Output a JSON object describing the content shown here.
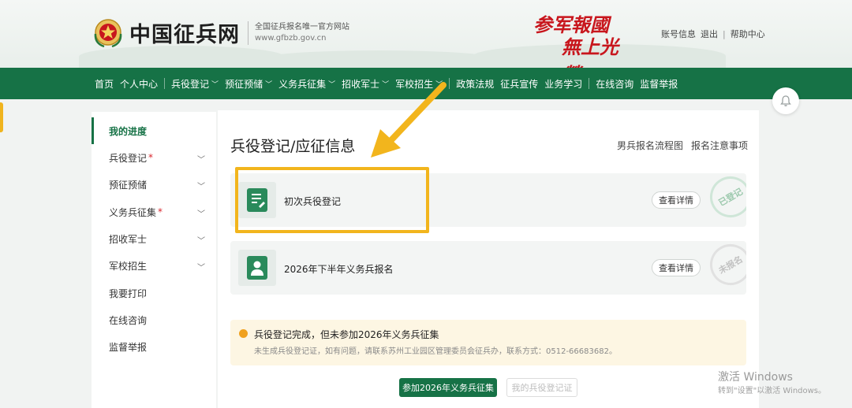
{
  "header": {
    "site_name": "中国征兵网",
    "slogan": "全国征兵报名唯一官方网站",
    "domain": "www.gfbzb.gov.cn",
    "calligraphy_line1": "参军報國",
    "calligraphy_line2": "無上光榮",
    "links": {
      "account": "账号信息",
      "logout": "退出",
      "sep": "|",
      "help": "帮助中心"
    }
  },
  "nav": {
    "items": [
      {
        "label": "首页"
      },
      {
        "label": "个人中心"
      },
      {
        "label": "兵役登记"
      },
      {
        "label": "预征预储"
      },
      {
        "label": "义务兵征集"
      },
      {
        "label": "招收军士"
      },
      {
        "label": "军校招生"
      },
      {
        "label": "政策法规"
      },
      {
        "label": "征兵宣传"
      },
      {
        "label": "业务学习"
      },
      {
        "label": "在线咨询"
      },
      {
        "label": "监督举报"
      }
    ]
  },
  "sidebar": {
    "items": [
      {
        "label": "我的进度"
      },
      {
        "label": "兵役登记",
        "star": "*"
      },
      {
        "label": "预征预储"
      },
      {
        "label": "义务兵征集",
        "star": "*"
      },
      {
        "label": "招收军士"
      },
      {
        "label": "军校招生"
      },
      {
        "label": "我要打印"
      },
      {
        "label": "在线咨询"
      },
      {
        "label": "监督举报"
      }
    ]
  },
  "main": {
    "title": "兵役登记/应征信息",
    "links": {
      "flowchart": "男兵报名流程图",
      "notice": "报名注意事项"
    },
    "cards": [
      {
        "title": "初次兵役登记",
        "button": "查看详情",
        "stamp": "已登记"
      },
      {
        "title": "2026年下半年义务兵报名",
        "button": "查看详情",
        "stamp": "未报名"
      }
    ],
    "notice": {
      "title": "兵役登记完成，但未参加2026年义务兵征集",
      "sub": "未生成兵役登记证，如有问题，请联系苏州工业园区管理委员会征兵办，联系方式：0512-66683682。"
    },
    "buttons": {
      "join": "参加2026年义务兵征集",
      "certificate": "我的兵役登记证"
    }
  },
  "watermark": {
    "title": "激活 Windows",
    "sub": "转到\"设置\"以激活 Windows。"
  },
  "colors": {
    "brand_green": "#167246",
    "highlight": "#f2b51d",
    "notice_bg": "#fdf6e3",
    "red": "#c8161d"
  }
}
